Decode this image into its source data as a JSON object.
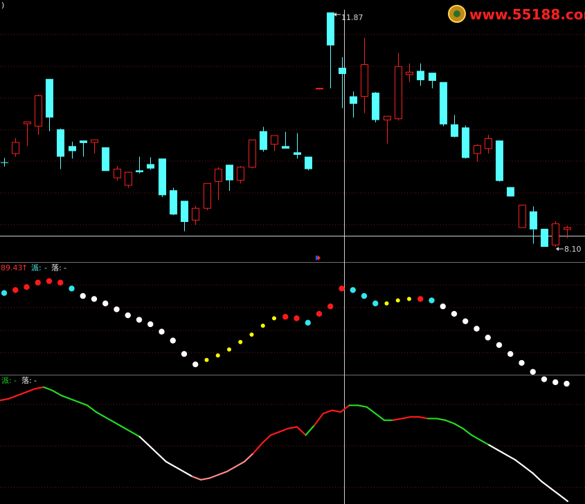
{
  "top_left_glyph": ")",
  "watermark": {
    "text": "www.55188.com",
    "color": "#ff2020"
  },
  "colors": {
    "background": "#000000",
    "grid": "#7a1a1a",
    "divider": "#6f6f6f",
    "crosshair": "#d0d0d0",
    "up_candle": "#ff2020",
    "down_candle": "#55ffff",
    "label_white": "#e6e6e6",
    "label_red": "#ff3030",
    "label_cyan": "#55ffff",
    "label_green": "#22dd22",
    "dot_red": "#ff1a1a",
    "dot_cyan": "#33e5ee",
    "dot_white": "#ffffff",
    "dot_yellow": "#ffff00",
    "line_red": "#ff1a1a",
    "line_green": "#22dd22",
    "line_white": "#ffffff",
    "line_pink": "#ff8a8a"
  },
  "main_panel": {
    "high_marker": "11.87",
    "low_marker": "8.10"
  },
  "indicator_panel": {
    "value_label": "89.43",
    "arrow": "↑",
    "label_a": "派:",
    "label_a_val": "-",
    "label_b": "落:",
    "label_b_val": "-"
  },
  "line_panel": {
    "label_a": "派:",
    "label_a_val": "-",
    "label_b": "落:",
    "label_b_val": "-"
  },
  "chart_data": [
    {
      "type": "candlestick",
      "title": "",
      "ylim": [
        8.0,
        12.2
      ],
      "grid": true,
      "candles": [
        {
          "o": 9.46,
          "h": 9.53,
          "l": 9.39,
          "c": 9.46,
          "dir": "down"
        },
        {
          "o": 9.6,
          "h": 9.85,
          "l": 9.55,
          "c": 9.78,
          "dir": "up"
        },
        {
          "o": 10.08,
          "h": 10.1,
          "l": 9.72,
          "c": 10.11,
          "dir": "up"
        },
        {
          "o": 10.04,
          "h": 10.55,
          "l": 9.9,
          "c": 10.53,
          "dir": "up"
        },
        {
          "o": 10.8,
          "h": 10.8,
          "l": 9.96,
          "c": 10.18,
          "dir": "down"
        },
        {
          "o": 9.99,
          "h": 10.0,
          "l": 9.35,
          "c": 9.55,
          "dir": "down"
        },
        {
          "o": 9.72,
          "h": 9.79,
          "l": 9.52,
          "c": 9.64,
          "dir": "down"
        },
        {
          "o": 9.81,
          "h": 9.81,
          "l": 9.55,
          "c": 9.77,
          "dir": "down"
        },
        {
          "o": 9.78,
          "h": 9.81,
          "l": 9.6,
          "c": 9.82,
          "dir": "up"
        },
        {
          "o": 9.7,
          "h": 9.7,
          "l": 9.32,
          "c": 9.32,
          "dir": "down"
        },
        {
          "o": 9.21,
          "h": 9.4,
          "l": 9.16,
          "c": 9.35,
          "dir": "up"
        },
        {
          "o": 9.09,
          "h": 9.31,
          "l": 9.05,
          "c": 9.3,
          "dir": "up"
        },
        {
          "o": 9.33,
          "h": 9.55,
          "l": 9.28,
          "c": 9.3,
          "dir": "down"
        },
        {
          "o": 9.43,
          "h": 9.54,
          "l": 9.34,
          "c": 9.36,
          "dir": "down"
        },
        {
          "o": 9.52,
          "h": 9.52,
          "l": 8.9,
          "c": 8.93,
          "dir": "down"
        },
        {
          "o": 9.01,
          "h": 9.05,
          "l": 8.61,
          "c": 8.62,
          "dir": "down"
        },
        {
          "o": 8.84,
          "h": 8.84,
          "l": 8.35,
          "c": 8.5,
          "dir": "down"
        },
        {
          "o": 8.53,
          "h": 8.76,
          "l": 8.45,
          "c": 8.72,
          "dir": "up"
        },
        {
          "o": 8.72,
          "h": 9.12,
          "l": 8.69,
          "c": 9.12,
          "dir": "up"
        },
        {
          "o": 9.15,
          "h": 9.38,
          "l": 8.85,
          "c": 9.35,
          "dir": "up"
        },
        {
          "o": 9.42,
          "h": 9.42,
          "l": 9.0,
          "c": 9.17,
          "dir": "down"
        },
        {
          "o": 9.17,
          "h": 9.4,
          "l": 9.12,
          "c": 9.38,
          "dir": "up"
        },
        {
          "o": 9.38,
          "h": 9.82,
          "l": 9.36,
          "c": 9.82,
          "dir": "up"
        },
        {
          "o": 9.96,
          "h": 10.03,
          "l": 9.63,
          "c": 9.66,
          "dir": "down"
        },
        {
          "o": 9.75,
          "h": 9.88,
          "l": 9.64,
          "c": 9.89,
          "dir": "up"
        },
        {
          "o": 9.72,
          "h": 9.95,
          "l": 9.68,
          "c": 9.68,
          "dir": "down"
        },
        {
          "o": 9.62,
          "h": 9.93,
          "l": 9.52,
          "c": 9.58,
          "dir": "down"
        },
        {
          "o": 9.55,
          "h": 9.55,
          "l": 9.33,
          "c": 9.35,
          "dir": "down"
        },
        {
          "o": 10.65,
          "h": 10.65,
          "l": 10.63,
          "c": 10.64,
          "dir": "up"
        },
        {
          "o": 11.87,
          "h": 11.87,
          "l": 10.65,
          "c": 11.34,
          "dir": "down"
        },
        {
          "o": 10.98,
          "h": 11.15,
          "l": 10.33,
          "c": 10.88,
          "dir": "down"
        },
        {
          "o": 10.52,
          "h": 10.6,
          "l": 10.18,
          "c": 10.4,
          "dir": "down"
        },
        {
          "o": 10.52,
          "h": 11.46,
          "l": 10.25,
          "c": 11.03,
          "dir": "up"
        },
        {
          "o": 10.58,
          "h": 10.59,
          "l": 10.1,
          "c": 10.14,
          "dir": "down"
        },
        {
          "o": 10.14,
          "h": 10.2,
          "l": 9.76,
          "c": 10.2,
          "dir": "up"
        },
        {
          "o": 10.16,
          "h": 11.22,
          "l": 10.13,
          "c": 11.0,
          "dir": "up"
        },
        {
          "o": 10.87,
          "h": 11.05,
          "l": 10.75,
          "c": 10.91,
          "dir": "up"
        },
        {
          "o": 10.93,
          "h": 11.05,
          "l": 10.69,
          "c": 10.78,
          "dir": "down"
        },
        {
          "o": 10.9,
          "h": 10.9,
          "l": 10.65,
          "c": 10.77,
          "dir": "down"
        },
        {
          "o": 10.75,
          "h": 10.75,
          "l": 10.04,
          "c": 10.07,
          "dir": "down"
        },
        {
          "o": 10.07,
          "h": 10.22,
          "l": 9.86,
          "c": 9.87,
          "dir": "down"
        },
        {
          "o": 10.02,
          "h": 10.05,
          "l": 9.52,
          "c": 9.53,
          "dir": "down"
        },
        {
          "o": 9.6,
          "h": 9.75,
          "l": 9.47,
          "c": 9.73,
          "dir": "up"
        },
        {
          "o": 9.68,
          "h": 9.9,
          "l": 9.6,
          "c": 9.84,
          "dir": "up"
        },
        {
          "o": 9.81,
          "h": 9.81,
          "l": 9.15,
          "c": 9.16,
          "dir": "down"
        },
        {
          "o": 9.06,
          "h": 9.06,
          "l": 8.91,
          "c": 8.91,
          "dir": "down"
        },
        {
          "o": 8.41,
          "h": 8.78,
          "l": 8.44,
          "c": 8.77,
          "dir": "up"
        },
        {
          "o": 8.67,
          "h": 8.75,
          "l": 8.15,
          "c": 8.38,
          "dir": "down"
        },
        {
          "o": 8.39,
          "h": 8.39,
          "l": 8.1,
          "c": 8.1,
          "dir": "down"
        },
        {
          "o": 8.13,
          "h": 8.51,
          "l": 8.1,
          "c": 8.47,
          "dir": "up"
        },
        {
          "o": 8.38,
          "h": 8.44,
          "l": 8.24,
          "c": 8.41,
          "dir": "up"
        }
      ],
      "annotations": [
        "11.87",
        "8.10"
      ]
    },
    {
      "type": "scatter",
      "title": "",
      "ylim": [
        0,
        100
      ],
      "series": [
        {
          "values": [
            88,
            90,
            92,
            95,
            96,
            95,
            91,
            86,
            84,
            81,
            77,
            73,
            70,
            67,
            62,
            56,
            47,
            40,
            43,
            46,
            50,
            55,
            60,
            66,
            71,
            72,
            71,
            68,
            74,
            79,
            91,
            90,
            86,
            81,
            81,
            83,
            84,
            84,
            83,
            79,
            74,
            69,
            64,
            58,
            53,
            47,
            41,
            35,
            30,
            28,
            27
          ],
          "colors": [
            "cyan",
            "red",
            "red",
            "red",
            "red",
            "red",
            "cyan",
            "white",
            "white",
            "white",
            "white",
            "white",
            "white",
            "white",
            "white",
            "white",
            "white",
            "white",
            "yellow",
            "yellow",
            "yellow",
            "yellow",
            "yellow",
            "yellow",
            "yellow",
            "red",
            "red",
            "cyan",
            "red",
            "red",
            "red",
            "cyan",
            "cyan",
            "cyan",
            "yellow",
            "yellow",
            "yellow",
            "red",
            "cyan",
            "white",
            "white",
            "white",
            "white",
            "white",
            "white",
            "white",
            "white",
            "white",
            "white",
            "white",
            "white"
          ]
        }
      ]
    },
    {
      "type": "line",
      "title": "",
      "ylim": [
        0,
        100
      ],
      "series": [
        {
          "values": [
            78,
            79,
            81,
            83,
            85,
            86,
            84,
            81,
            79,
            77,
            75,
            71,
            68,
            65,
            62,
            59,
            56,
            51,
            46,
            41,
            38,
            35,
            32,
            30,
            31,
            33,
            35,
            38,
            41,
            46,
            52,
            57,
            59,
            61,
            62,
            57,
            63,
            70,
            72,
            71,
            75,
            75,
            74,
            70,
            66,
            66,
            67,
            68,
            68,
            67,
            67,
            66,
            64,
            61,
            57,
            54,
            51,
            48,
            45,
            42,
            38,
            34,
            29,
            25,
            21,
            17
          ],
          "colors": [
            "red",
            "red",
            "red",
            "red",
            "red",
            "green",
            "green",
            "green",
            "green",
            "green",
            "green",
            "green",
            "green",
            "green",
            "green",
            "green",
            "white",
            "white",
            "white",
            "white",
            "white",
            "white",
            "pink",
            "pink",
            "pink",
            "pink",
            "pink",
            "pink",
            "pink",
            "red",
            "red",
            "red",
            "red",
            "red",
            "red",
            "green",
            "red",
            "red",
            "red",
            "red",
            "green",
            "green",
            "green",
            "green",
            "green",
            "red",
            "red",
            "red",
            "red",
            "green",
            "green",
            "green",
            "green",
            "green",
            "green",
            "green",
            "white",
            "white",
            "white",
            "white",
            "white",
            "white",
            "white",
            "white",
            "white",
            "white"
          ]
        }
      ]
    }
  ]
}
